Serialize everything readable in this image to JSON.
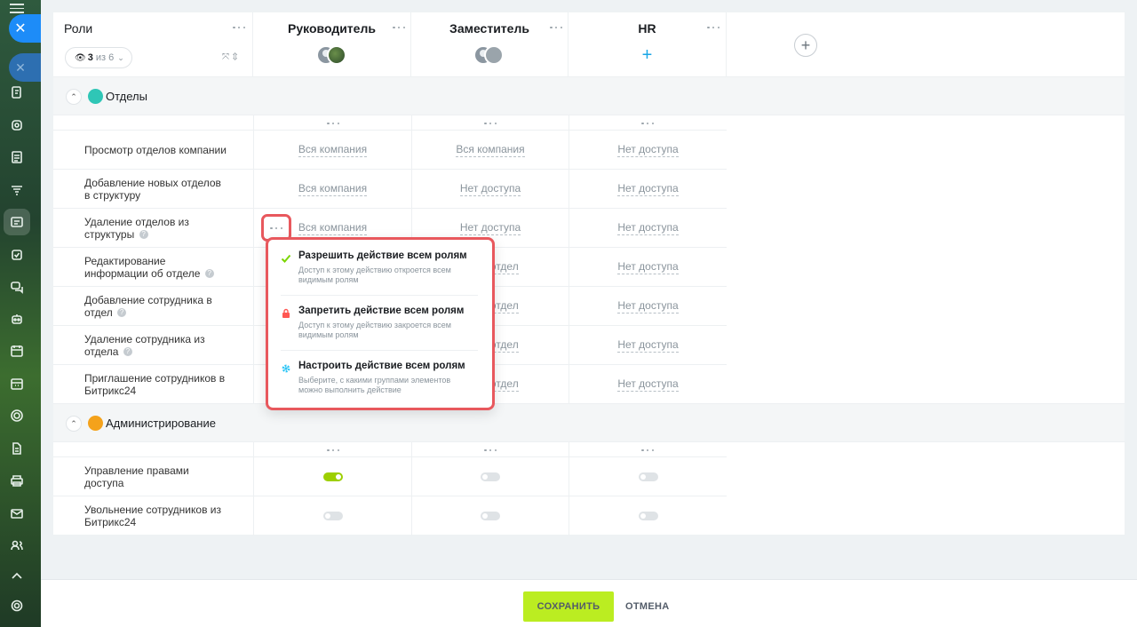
{
  "header": {
    "roles_title": "Роли",
    "counter": {
      "shown": "3",
      "of_label": "из 6"
    },
    "columns": [
      {
        "title": "Руководитель"
      },
      {
        "title": "Заместитель"
      },
      {
        "title": "HR"
      }
    ]
  },
  "sections": [
    {
      "title": "Отделы",
      "icon": "people-group-icon",
      "color": "#2fc6b6",
      "rows": [
        {
          "label": "Просмотр отделов компании",
          "values": [
            "Вся компания",
            "Вся компания",
            "Нет доступа"
          ]
        },
        {
          "label": "Добавление новых отделов в структуру",
          "values": [
            "Вся компания",
            "Нет доступа",
            "Нет доступа"
          ]
        },
        {
          "label": "Удаление отделов из структуры",
          "values": [
            "Вся компания",
            "Нет доступа",
            "Нет доступа"
          ]
        },
        {
          "label": "Редактирование информации об отделе",
          "values": [
            "",
            "Свой отдел",
            "Нет доступа"
          ]
        },
        {
          "label": "Добавление сотрудника в отдел",
          "values": [
            "",
            "Свой отдел",
            "Нет доступа"
          ]
        },
        {
          "label": "Удаление сотрудника из отдела",
          "values": [
            "",
            "Свой отдел",
            "Нет доступа"
          ]
        },
        {
          "label": "Приглашение сотрудников в Битрикс24",
          "values": [
            "",
            "Свой отдел",
            "Нет доступа"
          ]
        }
      ]
    },
    {
      "title": "Администрирование",
      "icon": "admin-person-icon",
      "color": "#f4a21b",
      "rows": [
        {
          "label": "Управление правами доступа",
          "toggles": [
            true,
            false,
            false
          ]
        },
        {
          "label": "Увольнение сотрудников из Битрикс24",
          "toggles": [
            false,
            false,
            false
          ]
        }
      ]
    }
  ],
  "popup": {
    "items": [
      {
        "title": "Разрешить действие всем ролям",
        "desc": "Доступ к этому действию откроется всем видимым ролям",
        "icon": "check-icon",
        "color": "#7bd500"
      },
      {
        "title": "Запретить действие всем ролям",
        "desc": "Доступ к этому действию закроется всем видимым ролям",
        "icon": "lock-icon",
        "color": "#ff5752"
      },
      {
        "title": "Настроить действие всем ролям",
        "desc": "Выберите, с какими группами элементов можно выполнить действие",
        "icon": "gear-icon",
        "color": "#2fc6f6"
      }
    ]
  },
  "footer": {
    "save_label": "СОХРАНИТЬ",
    "cancel_label": "ОТМЕНА"
  },
  "colors": {
    "accent_save": "#bbed21",
    "highlight": "#e8585d",
    "close_button": "#1d8cf8"
  }
}
